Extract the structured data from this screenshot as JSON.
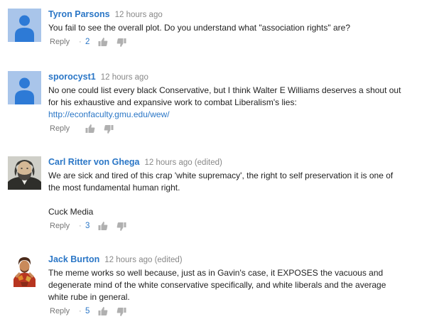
{
  "comments": [
    {
      "author": "Tyron Parsons",
      "time": "12 hours ago",
      "paragraphs": [
        "You fail to see the overall plot. Do you understand what \"association rights\" are?"
      ],
      "reply_label": "Reply",
      "separator": "·",
      "likes": "2",
      "avatar": "default-avatar-icon"
    },
    {
      "author": "sporocyst1",
      "time": "12 hours ago",
      "paragraphs": [
        "No one could list every black Conservative, but I think Walter E Williams deserves a shout out",
        "for his exhaustive and expansive work to combat Liberalism's lies:"
      ],
      "link": "http://econfaculty.gmu.edu/wew/",
      "reply_label": "Reply",
      "avatar": "default-avatar-icon"
    },
    {
      "author": "Carl Ritter von Ghega",
      "time": "12 hours ago (edited)",
      "paragraphs": [
        "We are sick and tired of this crap 'white supremacy', the right to self preservation it is one of",
        "the most fundamental human right."
      ],
      "extra_paragraph": "Cuck Media",
      "reply_label": "Reply",
      "separator": "·",
      "likes": "3",
      "avatar": "portrait-avatar"
    },
    {
      "author": "Jack Burton",
      "time": "12 hours ago (edited)",
      "paragraphs": [
        "The meme works so well because, just as in Gavin's case, it EXPOSES the vacuous and",
        "degenerate mind of the white conservative specifically, and white liberals and the average",
        "white rube in general."
      ],
      "reply_label": "Reply",
      "separator": "·",
      "likes": "5",
      "avatar": "photo-avatar"
    }
  ],
  "colors": {
    "author": "#2a76c6",
    "timestamp": "#888888",
    "body_text": "#222222",
    "default_avatar_bg": "#a9c5ea",
    "thumb_icon": "#b0b0b0"
  }
}
